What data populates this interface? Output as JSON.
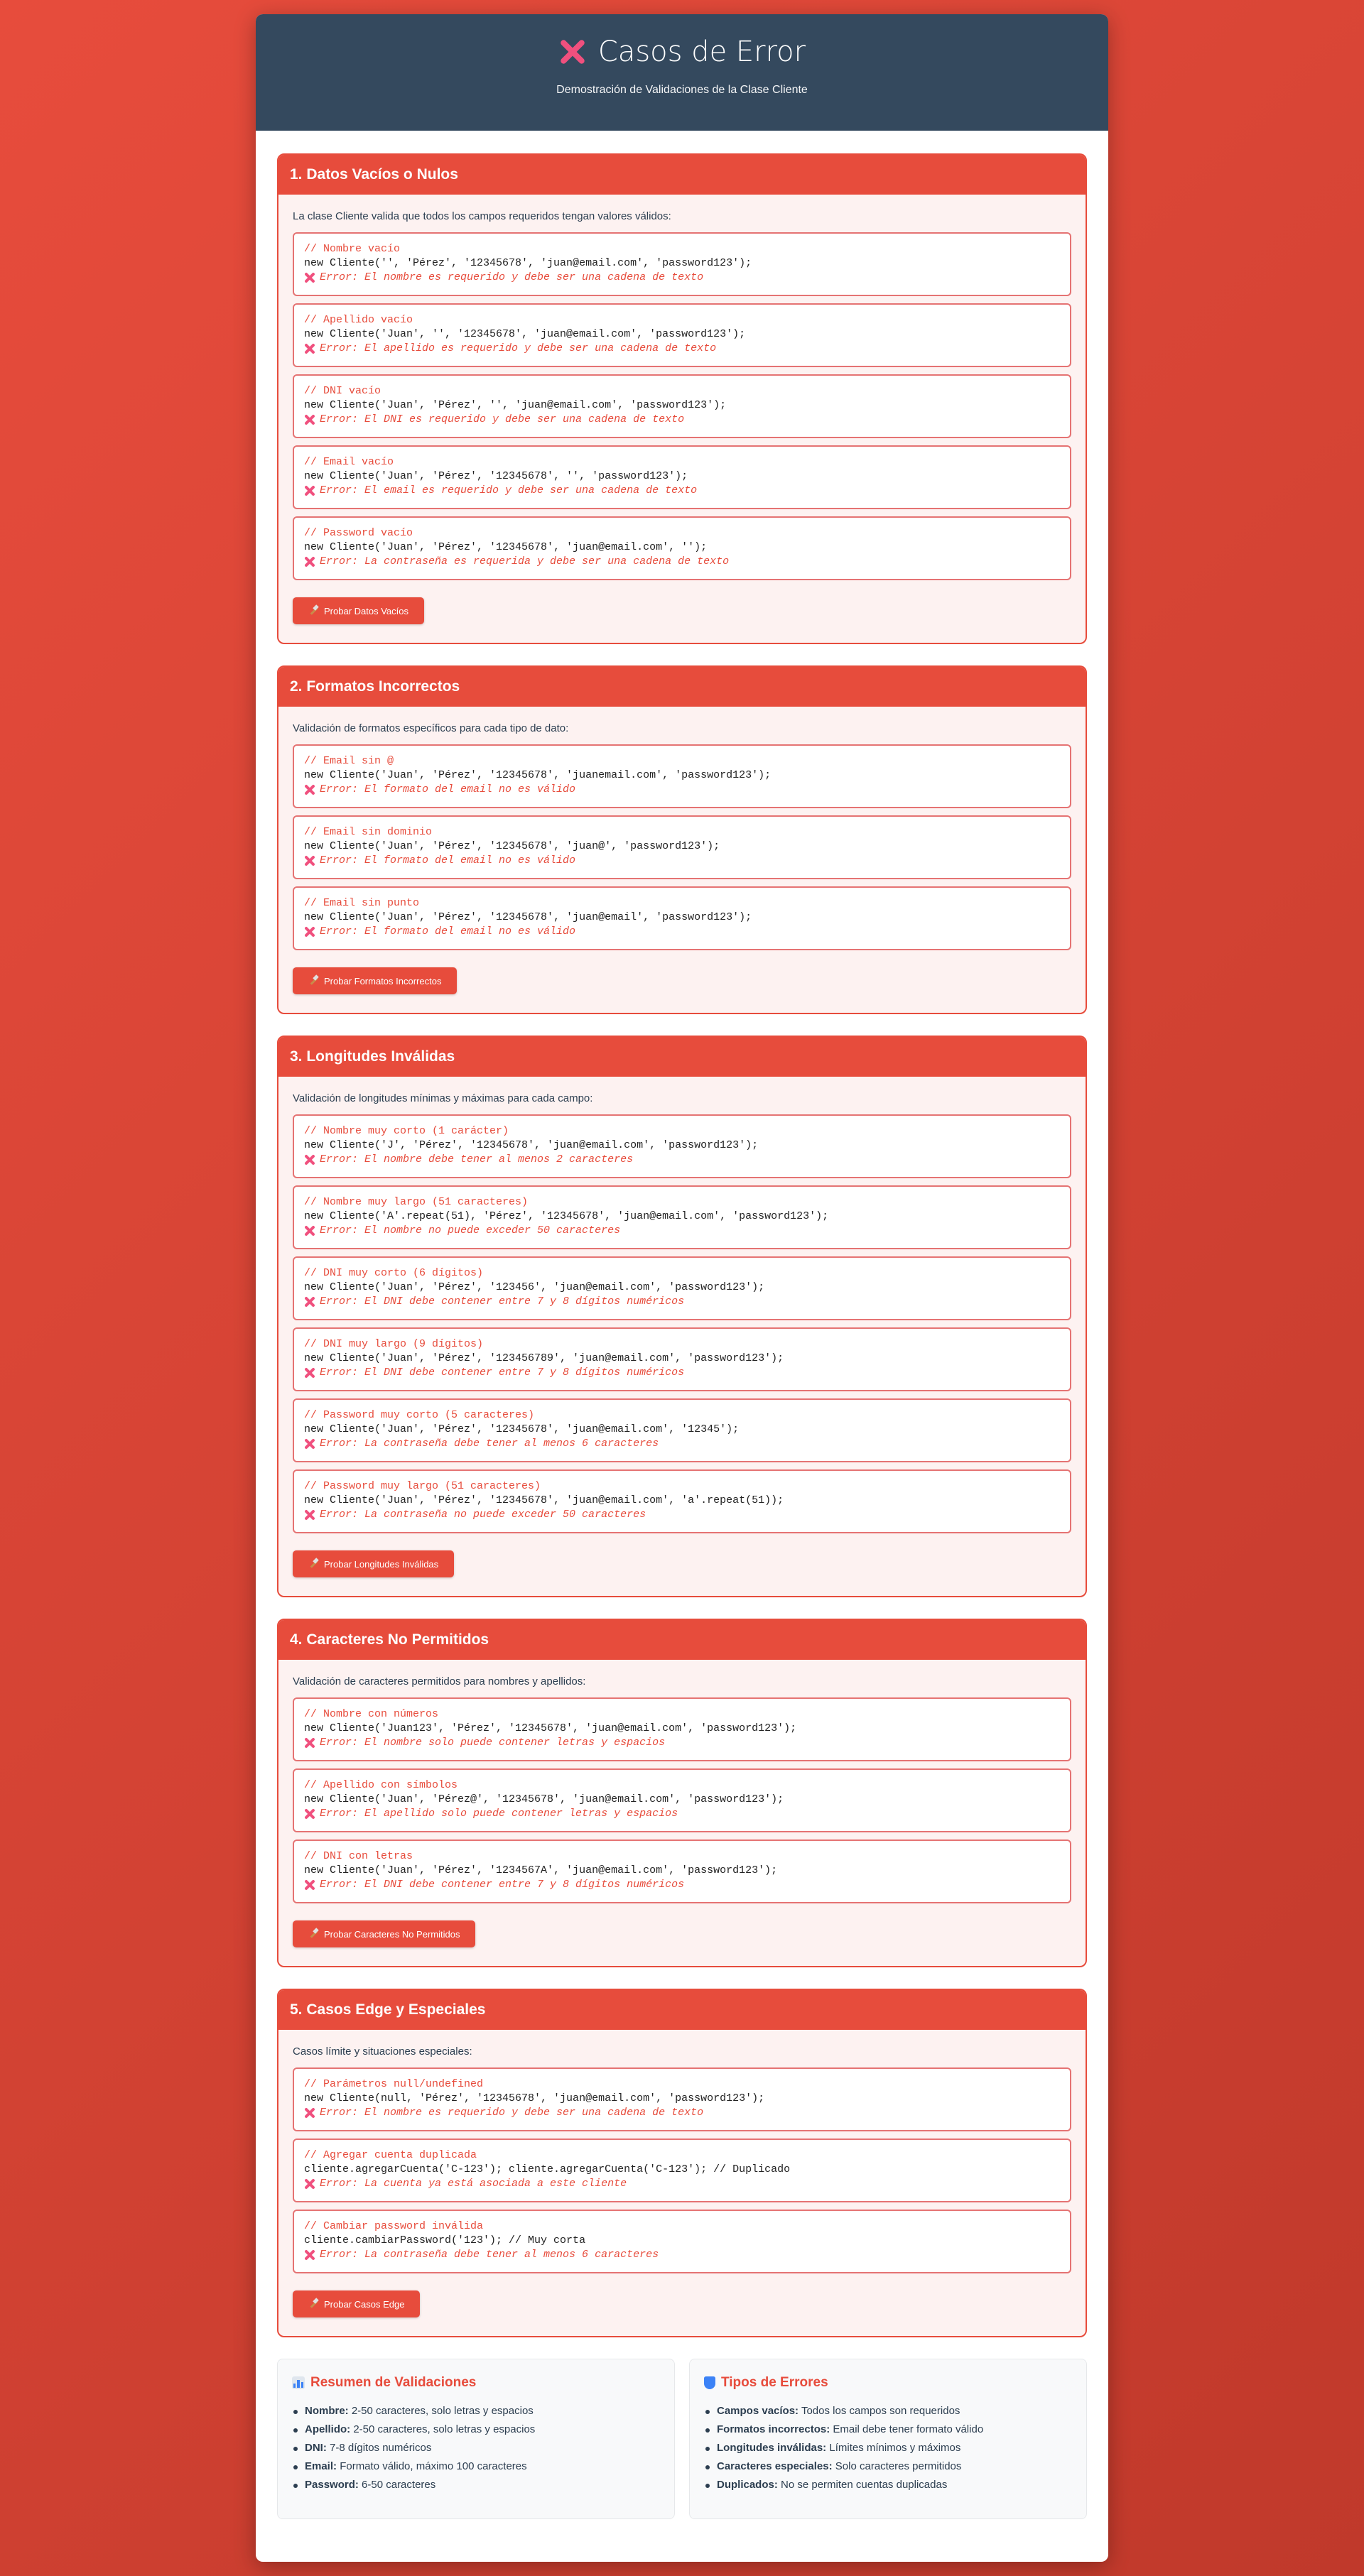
{
  "header": {
    "title": "Casos de Error",
    "subtitle": "Demostración de Validaciones de la Clase Cliente"
  },
  "sections": [
    {
      "title": "1. Datos Vacíos o Nulos",
      "intro": "La clase Cliente valida que todos los campos requeridos tengan valores válidos:",
      "button": "Probar Datos Vacíos",
      "cases": [
        {
          "comment": "// Nombre vacío",
          "code": "new Cliente('', 'Pérez', '12345678', 'juan@email.com', 'password123');",
          "error": "Error: El nombre es requerido y debe ser una cadena de texto"
        },
        {
          "comment": "// Apellido vacío",
          "code": "new Cliente('Juan', '', '12345678', 'juan@email.com', 'password123');",
          "error": "Error: El apellido es requerido y debe ser una cadena de texto"
        },
        {
          "comment": "// DNI vacío",
          "code": "new Cliente('Juan', 'Pérez', '', 'juan@email.com', 'password123');",
          "error": "Error: El DNI es requerido y debe ser una cadena de texto"
        },
        {
          "comment": "// Email vacío",
          "code": "new Cliente('Juan', 'Pérez', '12345678', '', 'password123');",
          "error": "Error: El email es requerido y debe ser una cadena de texto"
        },
        {
          "comment": "// Password vacío",
          "code": "new Cliente('Juan', 'Pérez', '12345678', 'juan@email.com', '');",
          "error": "Error: La contraseña es requerida y debe ser una cadena de texto"
        }
      ]
    },
    {
      "title": "2. Formatos Incorrectos",
      "intro": "Validación de formatos específicos para cada tipo de dato:",
      "button": "Probar Formatos Incorrectos",
      "cases": [
        {
          "comment": "// Email sin @",
          "code": "new Cliente('Juan', 'Pérez', '12345678', 'juanemail.com', 'password123');",
          "error": "Error: El formato del email no es válido"
        },
        {
          "comment": "// Email sin dominio",
          "code": "new Cliente('Juan', 'Pérez', '12345678', 'juan@', 'password123');",
          "error": "Error: El formato del email no es válido"
        },
        {
          "comment": "// Email sin punto",
          "code": "new Cliente('Juan', 'Pérez', '12345678', 'juan@email', 'password123');",
          "error": "Error: El formato del email no es válido"
        }
      ]
    },
    {
      "title": "3. Longitudes Inválidas",
      "intro": "Validación de longitudes mínimas y máximas para cada campo:",
      "button": "Probar Longitudes Inválidas",
      "cases": [
        {
          "comment": "// Nombre muy corto (1 carácter)",
          "code": "new Cliente('J', 'Pérez', '12345678', 'juan@email.com', 'password123');",
          "error": "Error: El nombre debe tener al menos 2 caracteres"
        },
        {
          "comment": "// Nombre muy largo (51 caracteres)",
          "code": "new Cliente('A'.repeat(51), 'Pérez', '12345678', 'juan@email.com', 'password123');",
          "error": "Error: El nombre no puede exceder 50 caracteres"
        },
        {
          "comment": "// DNI muy corto (6 dígitos)",
          "code": "new Cliente('Juan', 'Pérez', '123456', 'juan@email.com', 'password123');",
          "error": "Error: El DNI debe contener entre 7 y 8 dígitos numéricos"
        },
        {
          "comment": "// DNI muy largo (9 dígitos)",
          "code": "new Cliente('Juan', 'Pérez', '123456789', 'juan@email.com', 'password123');",
          "error": "Error: El DNI debe contener entre 7 y 8 dígitos numéricos"
        },
        {
          "comment": "// Password muy corto (5 caracteres)",
          "code": "new Cliente('Juan', 'Pérez', '12345678', 'juan@email.com', '12345');",
          "error": "Error: La contraseña debe tener al menos 6 caracteres"
        },
        {
          "comment": "// Password muy largo (51 caracteres)",
          "code": "new Cliente('Juan', 'Pérez', '12345678', 'juan@email.com', 'a'.repeat(51));",
          "error": "Error: La contraseña no puede exceder 50 caracteres"
        }
      ]
    },
    {
      "title": "4. Caracteres No Permitidos",
      "intro": "Validación de caracteres permitidos para nombres y apellidos:",
      "button": "Probar Caracteres No Permitidos",
      "cases": [
        {
          "comment": "// Nombre con números",
          "code": "new Cliente('Juan123', 'Pérez', '12345678', 'juan@email.com', 'password123');",
          "error": "Error: El nombre solo puede contener letras y espacios"
        },
        {
          "comment": "// Apellido con símbolos",
          "code": "new Cliente('Juan', 'Pérez@', '12345678', 'juan@email.com', 'password123');",
          "error": "Error: El apellido solo puede contener letras y espacios"
        },
        {
          "comment": "// DNI con letras",
          "code": "new Cliente('Juan', 'Pérez', '1234567A', 'juan@email.com', 'password123');",
          "error": "Error: El DNI debe contener entre 7 y 8 dígitos numéricos"
        }
      ]
    },
    {
      "title": "5. Casos Edge y Especiales",
      "intro": "Casos límite y situaciones especiales:",
      "button": "Probar Casos Edge",
      "cases": [
        {
          "comment": "// Parámetros null/undefined",
          "code": "new Cliente(null, 'Pérez', '12345678', 'juan@email.com', 'password123');",
          "error": "Error: El nombre es requerido y debe ser una cadena de texto"
        },
        {
          "comment": "// Agregar cuenta duplicada",
          "code": "cliente.agregarCuenta('C-123'); cliente.agregarCuenta('C-123'); // Duplicado",
          "error": "Error: La cuenta ya está asociada a este cliente"
        },
        {
          "comment": "// Cambiar password inválida",
          "code": "cliente.cambiarPassword('123'); // Muy corta",
          "error": "Error: La contraseña debe tener al menos 6 caracteres"
        }
      ]
    }
  ],
  "summary": {
    "validaciones": {
      "title": "Resumen de Validaciones",
      "items": [
        {
          "label": "Nombre:",
          "text": "2-50 caracteres, solo letras y espacios"
        },
        {
          "label": "Apellido:",
          "text": "2-50 caracteres, solo letras y espacios"
        },
        {
          "label": "DNI:",
          "text": "7-8 dígitos numéricos"
        },
        {
          "label": "Email:",
          "text": "Formato válido, máximo 100 caracteres"
        },
        {
          "label": "Password:",
          "text": "6-50 caracteres"
        }
      ]
    },
    "tipos": {
      "title": "Tipos de Errores",
      "items": [
        {
          "label": "Campos vacíos:",
          "text": "Todos los campos son requeridos"
        },
        {
          "label": "Formatos incorrectos:",
          "text": "Email debe tener formato válido"
        },
        {
          "label": "Longitudes inválidas:",
          "text": "Límites mínimos y máximos"
        },
        {
          "label": "Caracteres especiales:",
          "text": "Solo caracteres permitidos"
        },
        {
          "label": "Duplicados:",
          "text": "No se permiten cuentas duplicadas"
        }
      ]
    }
  },
  "colors": {
    "accent": "#e74c3c",
    "header_bg": "#34495e",
    "section_bg": "#fdf2f1"
  }
}
